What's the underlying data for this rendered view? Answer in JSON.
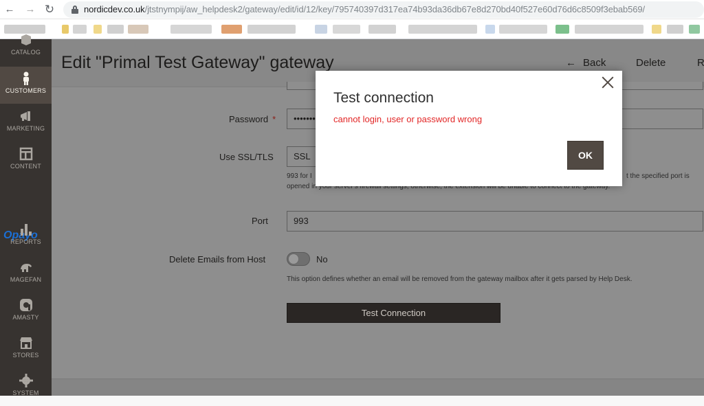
{
  "browser": {
    "back_glyph": "←",
    "forward_glyph": "→",
    "reload_glyph": "↻",
    "url_host": "nordicdev.co.uk",
    "url_path": "/jtstnympij/aw_helpdesk2/gateway/edit/id/12/key/795740397d317ea74b93da36db67e8d270bd40f527e60d76d6c8509f3ebab569/"
  },
  "sidebar": {
    "items": [
      {
        "label": "CATALOG",
        "icon": "catalog-icon"
      },
      {
        "label": "CUSTOMERS",
        "icon": "customers-icon",
        "active": true
      },
      {
        "label": "MARKETING",
        "icon": "marketing-icon"
      },
      {
        "label": "CONTENT",
        "icon": "content-icon"
      },
      {
        "label": "REPORTS",
        "icon": "reports-icon"
      },
      {
        "label": "MAGEFAN",
        "icon": "magefan-icon"
      },
      {
        "label": "AMASTY",
        "icon": "amasty-icon"
      },
      {
        "label": "STORES",
        "icon": "stores-icon"
      },
      {
        "label": "SYSTEM",
        "icon": "system-icon"
      }
    ],
    "opayo_logo": "Opayo"
  },
  "header": {
    "title": "Edit \"Primal Test Gateway\" gateway",
    "back_label": "Back",
    "delete_label": "Delete",
    "reset_label": "R"
  },
  "form": {
    "password_label": "Password",
    "password_required_mark": "*",
    "password_value": "•••••••",
    "ssl_label": "Use SSL/TLS",
    "ssl_value": "SSL",
    "ssl_note_line1_left": "993 for I",
    "ssl_note_line1_right": "t the specified port is",
    "ssl_note_line2": "opened in your server's firewall settings, otherwise, the extension will be unable to connect to the gateway.",
    "port_label": "Port",
    "port_value": "993",
    "delete_label": "Delete Emails from Host",
    "delete_value": "No",
    "delete_note": "This option defines whether an email will be removed from the gateway mailbox after it gets parsed by Help Desk.",
    "test_button": "Test Connection"
  },
  "modal": {
    "title": "Test connection",
    "message": "cannot login, user or password wrong",
    "ok_label": "OK"
  },
  "colors": {
    "error": "#e22626",
    "ok_button": "#514943",
    "sidebar_bg": "#373330"
  }
}
